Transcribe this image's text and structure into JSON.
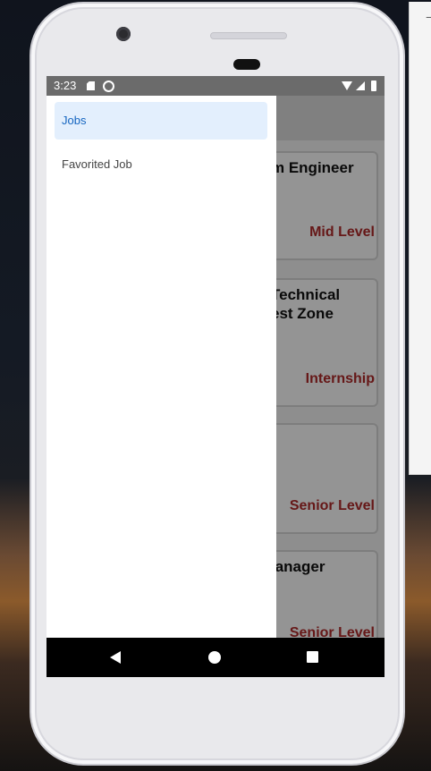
{
  "status_bar": {
    "time": "3:23"
  },
  "drawer": {
    "items": [
      {
        "label": "Jobs",
        "active": true
      },
      {
        "label": "Favorited Job",
        "active": false
      }
    ]
  },
  "jobs": [
    {
      "title": "m Engineer",
      "level": "Mid Level"
    },
    {
      "title": "Technical\nest Zone",
      "level": "Internship"
    },
    {
      "title": "",
      "level": "Senior Level"
    },
    {
      "title": "lanager",
      "level": "Senior Level"
    }
  ],
  "colors": {
    "accent": "#1565c0",
    "active_bg": "#e3effd",
    "level_text": "#b02a2a"
  },
  "icons": {
    "status": [
      "sd-card-icon",
      "sync-icon",
      "wifi-icon",
      "cell-signal-icon",
      "battery-icon"
    ],
    "nav": [
      "back-icon",
      "home-icon",
      "recents-icon"
    ]
  }
}
